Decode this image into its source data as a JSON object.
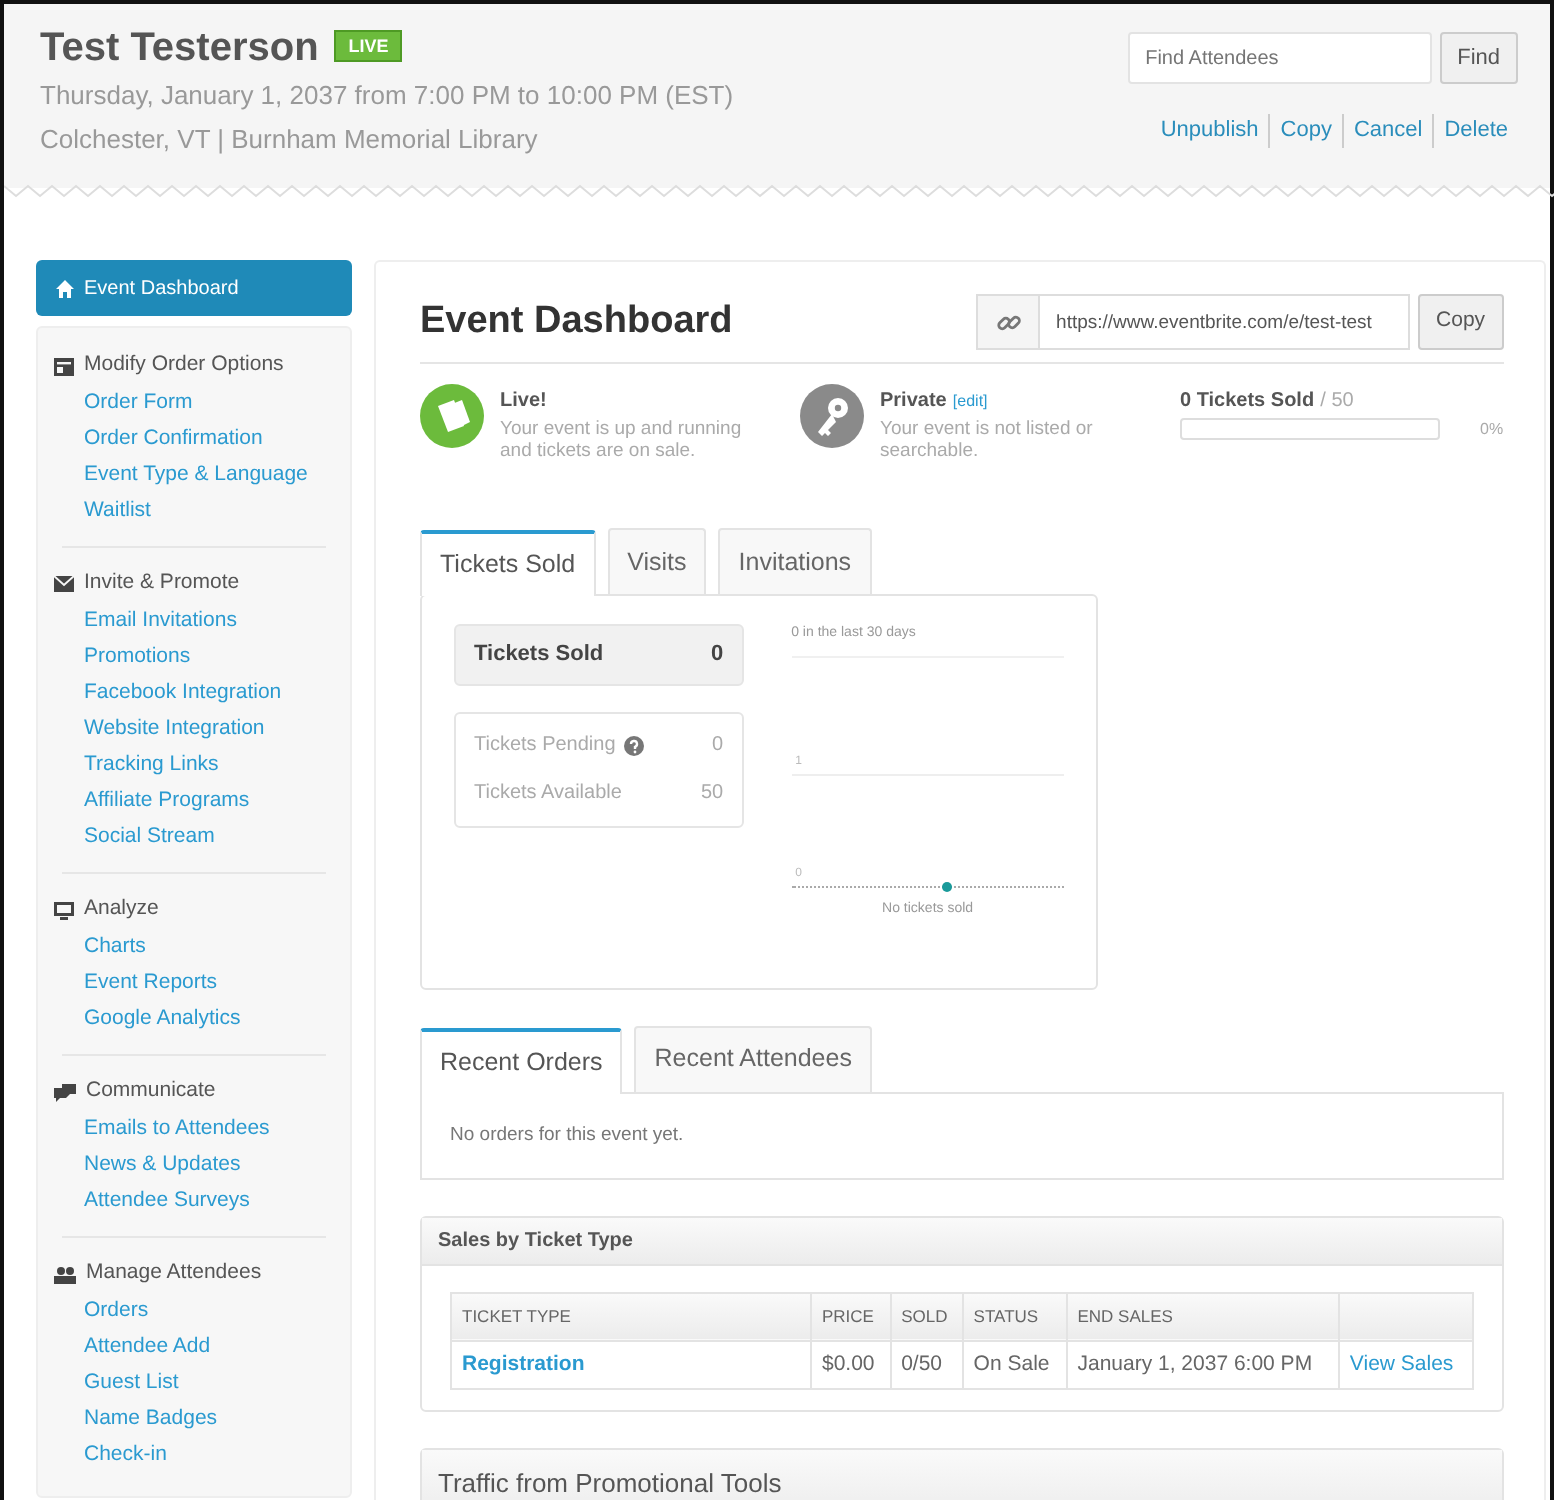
{
  "header": {
    "title": "Test Testerson",
    "badge": "LIVE",
    "date": "Thursday, January 1, 2037 from 7:00 PM to 10:00 PM (EST)",
    "location": "Colchester, VT | Burnham Memorial Library",
    "search": {
      "placeholder": "Find Attendees",
      "button": "Find"
    },
    "actions": [
      "Unpublish",
      "Copy",
      "Cancel",
      "Delete"
    ]
  },
  "sidebar": {
    "active": {
      "label": "Event Dashboard",
      "selected": true
    },
    "groups": [
      {
        "label": "Modify Order Options",
        "items": [
          "Order Form",
          "Order Confirmation",
          "Event Type & Language",
          "Waitlist"
        ]
      },
      {
        "label": "Invite & Promote",
        "items": [
          "Email Invitations",
          "Promotions",
          "Facebook Integration",
          "Website Integration",
          "Tracking Links",
          "Affiliate Programs",
          "Social Stream"
        ]
      },
      {
        "label": "Analyze",
        "items": [
          "Charts",
          "Event Reports",
          "Google Analytics"
        ]
      },
      {
        "label": "Communicate",
        "items": [
          "Emails to Attendees",
          "News & Updates",
          "Attendee Surveys"
        ]
      },
      {
        "label": "Manage Attendees",
        "items": [
          "Orders",
          "Attendee Add",
          "Guest List",
          "Name Badges",
          "Check-in"
        ]
      }
    ]
  },
  "main": {
    "title": "Event Dashboard",
    "url": "https://www.eventbrite.com/e/test-test",
    "copy": "Copy",
    "statuses": [
      {
        "kind": "live",
        "title": "Live!",
        "text": "Your event is up and running and tickets are on sale."
      },
      {
        "kind": "private",
        "title": "Private",
        "link": "[edit]",
        "text": "Your event is not listed or searchable."
      }
    ],
    "sold": {
      "count": "0 Tickets Sold",
      "total": "/ 50",
      "level": 0,
      "percent": "0%"
    },
    "tabs": [
      {
        "label": "Tickets Sold",
        "selected": true
      },
      {
        "label": "Visits",
        "selected": false
      },
      {
        "label": "Invitations",
        "selected": false
      }
    ],
    "summary": {
      "label": "Tickets Sold",
      "value": "0"
    },
    "details": [
      {
        "label": "Tickets Pending",
        "value": "0",
        "help": true
      },
      {
        "label": "Tickets Available",
        "value": "50",
        "help": false
      }
    ],
    "activity": {
      "title": "0 in the last 30 days",
      "axis_labels": [
        "1",
        "0"
      ],
      "caption": "No tickets sold"
    },
    "order_tabs": [
      {
        "label": "Recent Orders",
        "selected": true
      },
      {
        "label": "Recent Attendees",
        "selected": false
      }
    ],
    "orders_message": "No orders for this event yet.",
    "sales": {
      "title": "Sales by Ticket Type",
      "columns": [
        "TICKET TYPE",
        "PRICE",
        "SOLD",
        "STATUS",
        "END SALES"
      ],
      "rows": [
        {
          "name": "Registration",
          "price": "$0.00",
          "sold": "0/50",
          "status": "On Sale",
          "end": "January 1, 2037 6:00 PM",
          "action": "View Sales"
        }
      ]
    },
    "traffic": {
      "title": "Traffic from Promotional Tools"
    }
  }
}
